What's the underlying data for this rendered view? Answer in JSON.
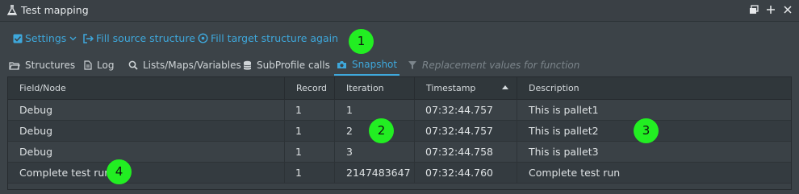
{
  "window": {
    "title": "Test mapping",
    "icon": "flask-icon",
    "controls": [
      "restore-icon",
      "add-icon",
      "close-icon"
    ]
  },
  "toolbar": {
    "settings_label": "Settings",
    "fill_source_label": "Fill source structure",
    "fill_target_label": "Fill target structure again"
  },
  "tabs": [
    {
      "label": "Structures",
      "icon": "folder-icon"
    },
    {
      "label": "Log",
      "icon": "document-icon"
    },
    {
      "label": "Lists/Maps/Variables",
      "icon": "search-icon"
    },
    {
      "label": "SubProfile calls",
      "icon": "database-icon"
    },
    {
      "label": "Snapshot",
      "icon": "camera-icon",
      "active": true
    },
    {
      "label": "Replacement values for function",
      "icon": "filter-icon",
      "disabled": true
    }
  ],
  "table": {
    "columns": [
      "Field/Node",
      "Record",
      "Iteration",
      "Timestamp",
      "Description"
    ],
    "rows": [
      [
        "Debug",
        "1",
        "1",
        "07:32:44.757",
        "This is pallet1"
      ],
      [
        "Debug",
        "1",
        "2",
        "07:32:44.757",
        "This is pallet2"
      ],
      [
        "Debug",
        "1",
        "3",
        "07:32:44.758",
        "This is pallet3"
      ],
      [
        "Complete test run",
        "1",
        "2147483647",
        "07:32:44.760",
        "Complete test run"
      ]
    ]
  },
  "annotations": [
    "1",
    "2",
    "3",
    "4"
  ],
  "colors": {
    "accent": "#3ea8dc",
    "background": "#3c4348",
    "annotation": "#22ee22"
  }
}
